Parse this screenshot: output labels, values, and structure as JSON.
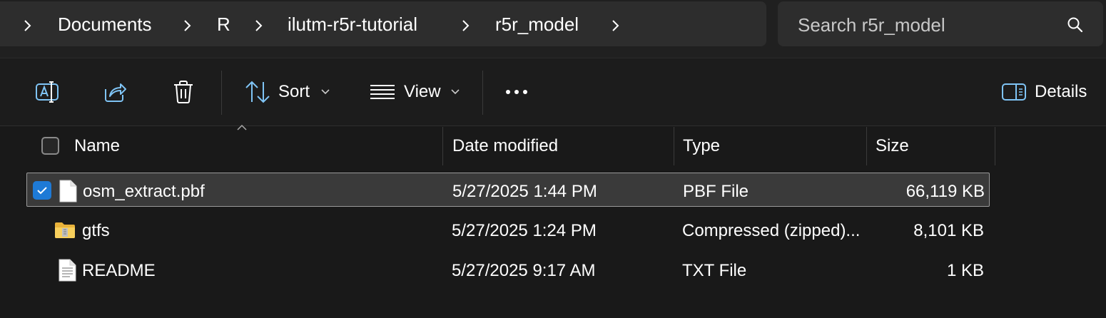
{
  "address_bar": {
    "crumbs": [
      "Documents",
      "R",
      "ilutm-r5r-tutorial",
      "r5r_model"
    ],
    "search_placeholder": "Search r5r_model"
  },
  "command_bar": {
    "sort_label": "Sort",
    "view_label": "View",
    "details_label": "Details"
  },
  "columns": {
    "name": "Name",
    "date": "Date modified",
    "type": "Type",
    "size": "Size"
  },
  "files": [
    {
      "name": "osm_extract.pbf",
      "date": "5/27/2025 1:44 PM",
      "type": "PBF File",
      "size": "66,119 KB",
      "icon": "file-icon",
      "selected": true
    },
    {
      "name": "gtfs",
      "date": "5/27/2025 1:24 PM",
      "type": "Compressed (zipped)...",
      "size": "8,101 KB",
      "icon": "zip-folder-icon",
      "selected": false
    },
    {
      "name": "README",
      "date": "5/27/2025 9:17 AM",
      "type": "TXT File",
      "size": "1 KB",
      "icon": "text-file-icon",
      "selected": false
    }
  ],
  "colors": {
    "accent": "#1e7ad6",
    "background": "#191919",
    "panel": "#2d2d2d"
  }
}
